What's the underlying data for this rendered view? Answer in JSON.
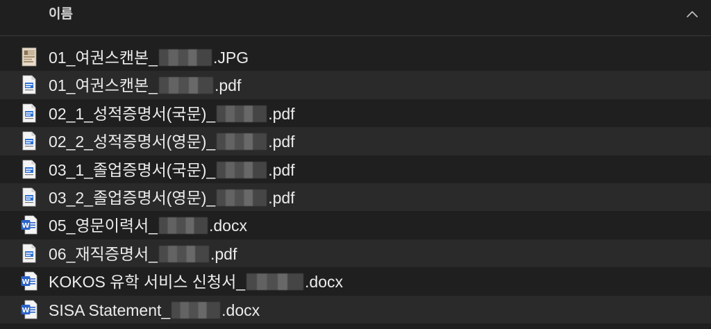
{
  "header": {
    "column_label": "이름",
    "sort_icon": "chevron-up-icon"
  },
  "files": [
    {
      "type": "jpg",
      "prefix": "01_여권스캔본_",
      "suffix": ".JPG",
      "icon": "image-file-icon"
    },
    {
      "type": "pdf",
      "prefix": "01_여권스캔본_",
      "suffix": ".pdf",
      "icon": "pdf-file-icon"
    },
    {
      "type": "pdf",
      "prefix": "02_1_성적증명서(국문)_",
      "suffix": ".pdf",
      "icon": "pdf-file-icon"
    },
    {
      "type": "pdf",
      "prefix": "02_2_성적증명서(영문)_",
      "suffix": ".pdf",
      "icon": "pdf-file-icon"
    },
    {
      "type": "pdf",
      "prefix": "03_1_졸업증명서(국문)_",
      "suffix": ".pdf",
      "icon": "pdf-file-icon"
    },
    {
      "type": "pdf",
      "prefix": "03_2_졸업증명서(영문)_",
      "suffix": ".pdf",
      "icon": "pdf-file-icon"
    },
    {
      "type": "docx",
      "prefix": "05_영문이력서_",
      "suffix": ".docx",
      "icon": "word-file-icon"
    },
    {
      "type": "pdf",
      "prefix": "06_재직증명서_",
      "suffix": ".pdf",
      "icon": "pdf-file-icon"
    },
    {
      "type": "docx",
      "prefix": "KOKOS 유학 서비스 신청서_",
      "suffix": ".docx",
      "icon": "word-file-icon"
    },
    {
      "type": "docx",
      "prefix": "SISA Statement_",
      "suffix": ".docx",
      "icon": "word-file-icon"
    }
  ],
  "colors": {
    "background": "#1f1f1f",
    "row_alt": "#2a2a2a",
    "text": "#ececec",
    "word_blue": "#2b63c9"
  }
}
